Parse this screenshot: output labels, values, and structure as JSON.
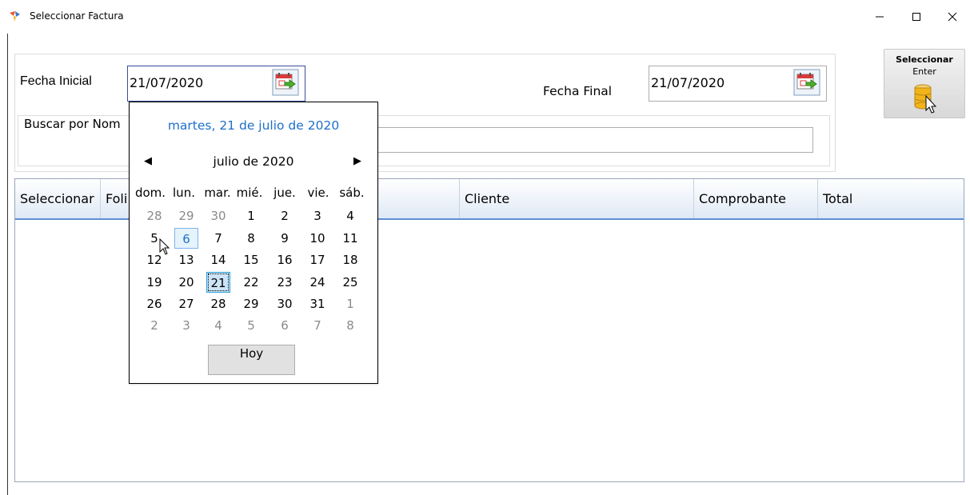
{
  "window": {
    "title": "Seleccionar Factura",
    "minimize": "—",
    "maximize": "☐",
    "close": "✕"
  },
  "filters": {
    "fecha_inicial_label": "Fecha Inicial",
    "fecha_inicial_value": "21/07/2020",
    "fecha_final_label": "Fecha Final",
    "fecha_final_value": "21/07/2020",
    "buscar_label": "Buscar por Nom",
    "buscar_value": ""
  },
  "select_button": {
    "title": "Seleccionar",
    "subtitle": "Enter"
  },
  "grid": {
    "columns": [
      "Seleccionar",
      "Foli",
      "Cliente",
      "Comprobante",
      "Total"
    ]
  },
  "calendar": {
    "today_long": "martes, 21 de julio de 2020",
    "month_label": "julio de 2020",
    "prev": "◀",
    "next": "▶",
    "days_of_week": [
      "dom.",
      "lun.",
      "mar.",
      "mié.",
      "jue.",
      "vie.",
      "sáb."
    ],
    "weeks": [
      [
        "28",
        "29",
        "30",
        "1",
        "2",
        "3",
        "4"
      ],
      [
        "5",
        "6",
        "7",
        "8",
        "9",
        "10",
        "11"
      ],
      [
        "12",
        "13",
        "14",
        "15",
        "16",
        "17",
        "18"
      ],
      [
        "19",
        "20",
        "21",
        "22",
        "23",
        "24",
        "25"
      ],
      [
        "26",
        "27",
        "28",
        "29",
        "30",
        "31",
        "1"
      ],
      [
        "2",
        "3",
        "4",
        "5",
        "6",
        "7",
        "8"
      ]
    ],
    "selected_day": "21",
    "hovered_day": "6",
    "today_button": "Hoy"
  },
  "colors": {
    "accent": "#1e6fc9",
    "header_border": "#5e8fd6",
    "selection": "#cce4f7"
  }
}
